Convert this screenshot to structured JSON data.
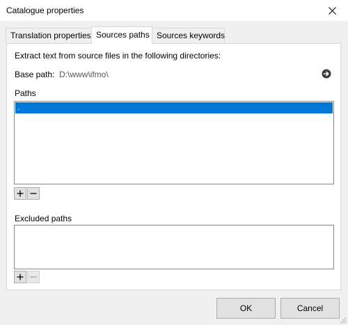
{
  "window": {
    "title": "Catalogue properties"
  },
  "tabs": [
    {
      "label": "Translation properties",
      "active": false
    },
    {
      "label": "Sources paths",
      "active": true
    },
    {
      "label": "Sources keywords",
      "active": false
    }
  ],
  "sources": {
    "instruction": "Extract text from source files in the following directories:",
    "base_path_label": "Base path:",
    "base_path_value": "D:\\www\\ifmo\\",
    "paths_label": "Paths",
    "paths": [
      {
        "value": ".",
        "selected": true
      }
    ],
    "excluded_label": "Excluded paths",
    "excluded_paths": []
  },
  "buttons": {
    "ok": "OK",
    "cancel": "Cancel"
  },
  "colors": {
    "selection": "#0078d7",
    "panel": "#ffffff",
    "chrome": "#f0f0f0"
  },
  "icons": {
    "close": "close-icon",
    "base_path_action": "arrow-right-circle-icon",
    "add": "plus-icon",
    "remove": "minus-icon"
  }
}
